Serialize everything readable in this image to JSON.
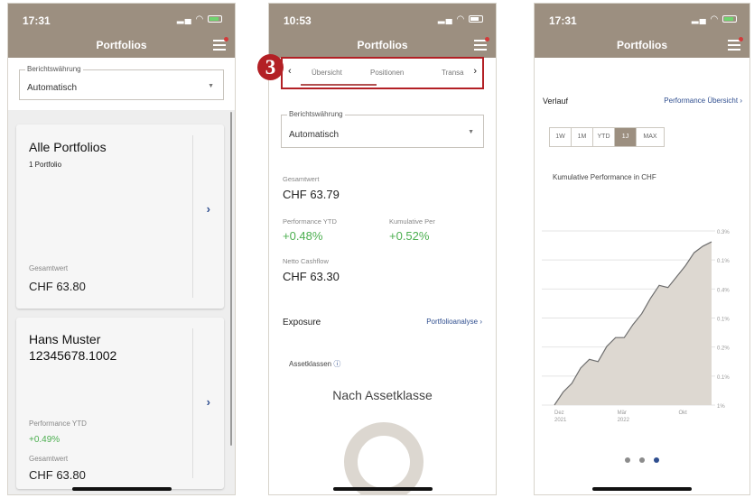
{
  "phones": [
    {
      "status": {
        "time": "17:31"
      },
      "header": {
        "title": "Portfolios"
      },
      "select": {
        "legend": "Berichtswährung",
        "value": "Automatisch"
      },
      "cards": [
        {
          "title": "Alle Portfolios",
          "sub": "1 Portfolio",
          "value_label": "Gesamtwert",
          "value": "CHF 63.80"
        },
        {
          "title_line1": "Hans Muster",
          "title_line2": "12345678.1002",
          "perf_label": "Performance YTD",
          "perf": "+0.49%",
          "value_label": "Gesamtwert",
          "value": "CHF 63.80"
        }
      ]
    },
    {
      "status": {
        "time": "10:53"
      },
      "header": {
        "title": "Portfolios"
      },
      "annotation": "3",
      "tabs": [
        "Übersicht",
        "Positionen",
        "Transa"
      ],
      "select": {
        "legend": "Berichtswährung",
        "value": "Automatisch"
      },
      "total_label": "Gesamtwert",
      "total": "CHF 63.79",
      "perf_ytd_label": "Performance YTD",
      "perf_ytd": "+0.48%",
      "perf_cum_label": "Kumulative Per",
      "perf_cum": "+0.52%",
      "cashflow_label": "Netto Cashflow",
      "cashflow": "CHF 63.30",
      "exposure": {
        "title": "Exposure",
        "link": "Portfolioanalyse ›"
      },
      "assets": {
        "label": "Assetklassen",
        "title": "Nach Assetklasse"
      }
    },
    {
      "status": {
        "time": "17:31"
      },
      "header": {
        "title": "Portfolios"
      },
      "verlauf": {
        "title": "Verlauf",
        "link": "Performance Übersicht ›"
      },
      "periods": [
        "1W",
        "1M",
        "YTD",
        "1J",
        "MAX"
      ],
      "active_period": "1J",
      "chart_title": "Kumulative Performance in CHF"
    }
  ],
  "colors": {
    "header": "#9c8f80",
    "positive": "#4caf50",
    "link": "#2f4e8f",
    "annotation": "#b32025"
  },
  "chart_data": {
    "type": "area",
    "title": "Kumulative Performance in CHF",
    "x_tick_labels": [
      [
        "Dez",
        "2021"
      ],
      [
        "Mär",
        "2022"
      ],
      [
        "Okt",
        ""
      ]
    ],
    "y_tick_labels": [
      "0.3%",
      "0.1%",
      "0.4%",
      "0.1%",
      "0.2%",
      "0.1%",
      "1%"
    ],
    "values": [
      0.0,
      0.06,
      0.1,
      0.17,
      0.21,
      0.2,
      0.27,
      0.31,
      0.31,
      0.37,
      0.42,
      0.49,
      0.55,
      0.54,
      0.59,
      0.64,
      0.7,
      0.73,
      0.75
    ],
    "ylim": [
      0,
      0.8
    ],
    "grid": true
  }
}
